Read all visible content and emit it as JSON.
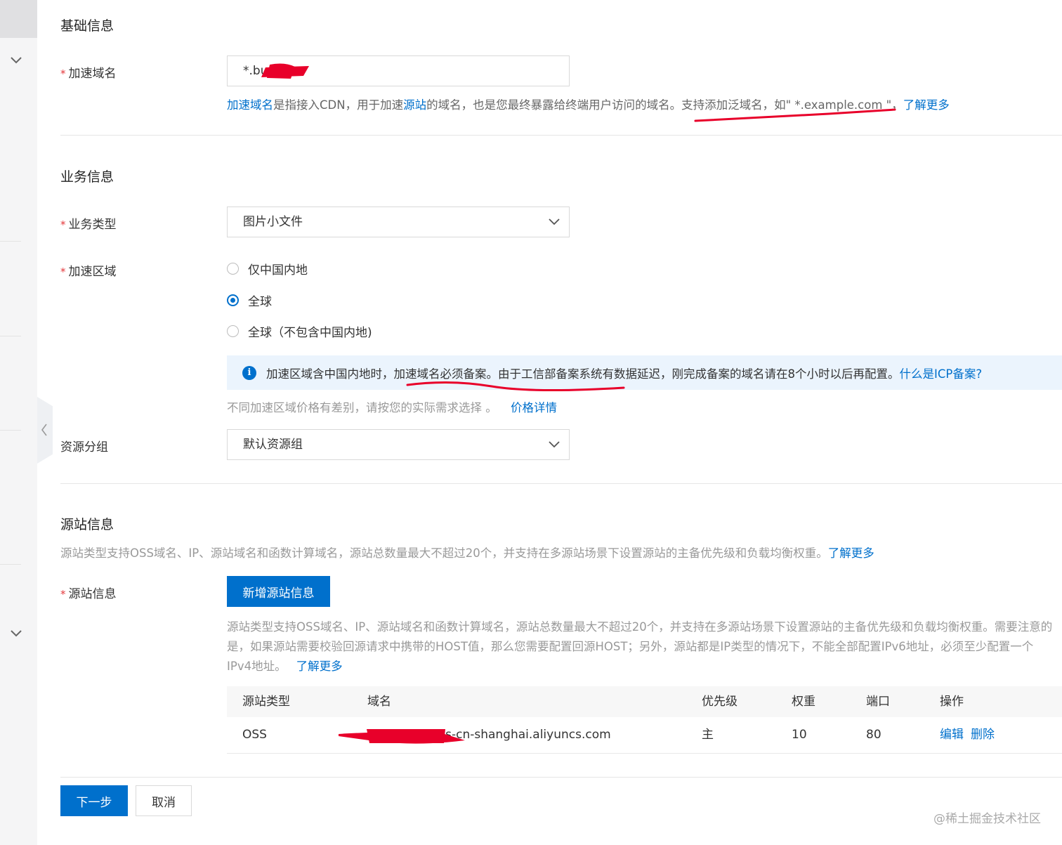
{
  "basic": {
    "section_title": "基础信息",
    "domain_label": "加速域名",
    "domain_value": "*.bu       om",
    "desc": {
      "link1": "加速域名",
      "text1": "是指接入CDN，用于加速",
      "link2": "源站",
      "text2": "的域名，也是您最终暴露给终端用户访问的域名。支持添加泛域名，如\" *.example.com \"，",
      "link3": "了解更多"
    }
  },
  "business": {
    "section_title": "业务信息",
    "type_label": "业务类型",
    "type_value": "图片小文件",
    "region_label": "加速区域",
    "region_options": [
      "仅中国内地",
      "全球",
      "全球（不包含中国内地)"
    ],
    "notice_icon": "i",
    "notice_text": "加速区域含中国内地时，加速域名必须备案。由于工信部备案系统有数据延迟，刚完成备案的域名请在8个小时以后再配置。",
    "notice_link": "什么是ICP备案?",
    "price_text": "不同加速区域价格有差别，请按您的实际需求选择 。",
    "price_link": "价格详情",
    "group_label": "资源分组",
    "group_value": "默认资源组"
  },
  "origin": {
    "section_title": "源站信息",
    "section_desc": "源站类型支持OSS域名、IP、源站域名和函数计算域名，源站总数量最大不超过20个，并支持在多源站场景下设置源站的主备优先级和负载均衡权重。",
    "section_link": "了解更多",
    "field_label": "源站信息",
    "add_button": "新增源站信息",
    "help_line1": "源站类型支持OSS域名、IP、源站域名和函数计算域名，源站总数量最大不超过20个，并支持在多源站场景下设置源站的主备优先级和负载均衡权重。需要注意的",
    "help_line2": "是，如果源站需要校验回源请求中携带的HOST值，那么您需要配置回源HOST；另外，源站都是IP类型的情况下，不能全部配置IPv6地址，必须至少配置一个",
    "help_line3": "IPv4地址。",
    "help_link": "了解更多",
    "table": {
      "headers": [
        "源站类型",
        "域名",
        "优先级",
        "权重",
        "端口",
        "操作"
      ],
      "row": {
        "type": "OSS",
        "domain": "b               oss-cn-shanghai.aliyuncs.com",
        "priority": "主",
        "weight": "10",
        "port": "80",
        "edit": "编辑",
        "delete": "删除"
      }
    }
  },
  "footer": {
    "next_button": "下一步",
    "cancel_button": "取消"
  },
  "watermark": "@稀土掘金技术社区",
  "colors": {
    "accent": "#0070cc",
    "required": "#e4393c",
    "annotation": "#e8002a"
  }
}
